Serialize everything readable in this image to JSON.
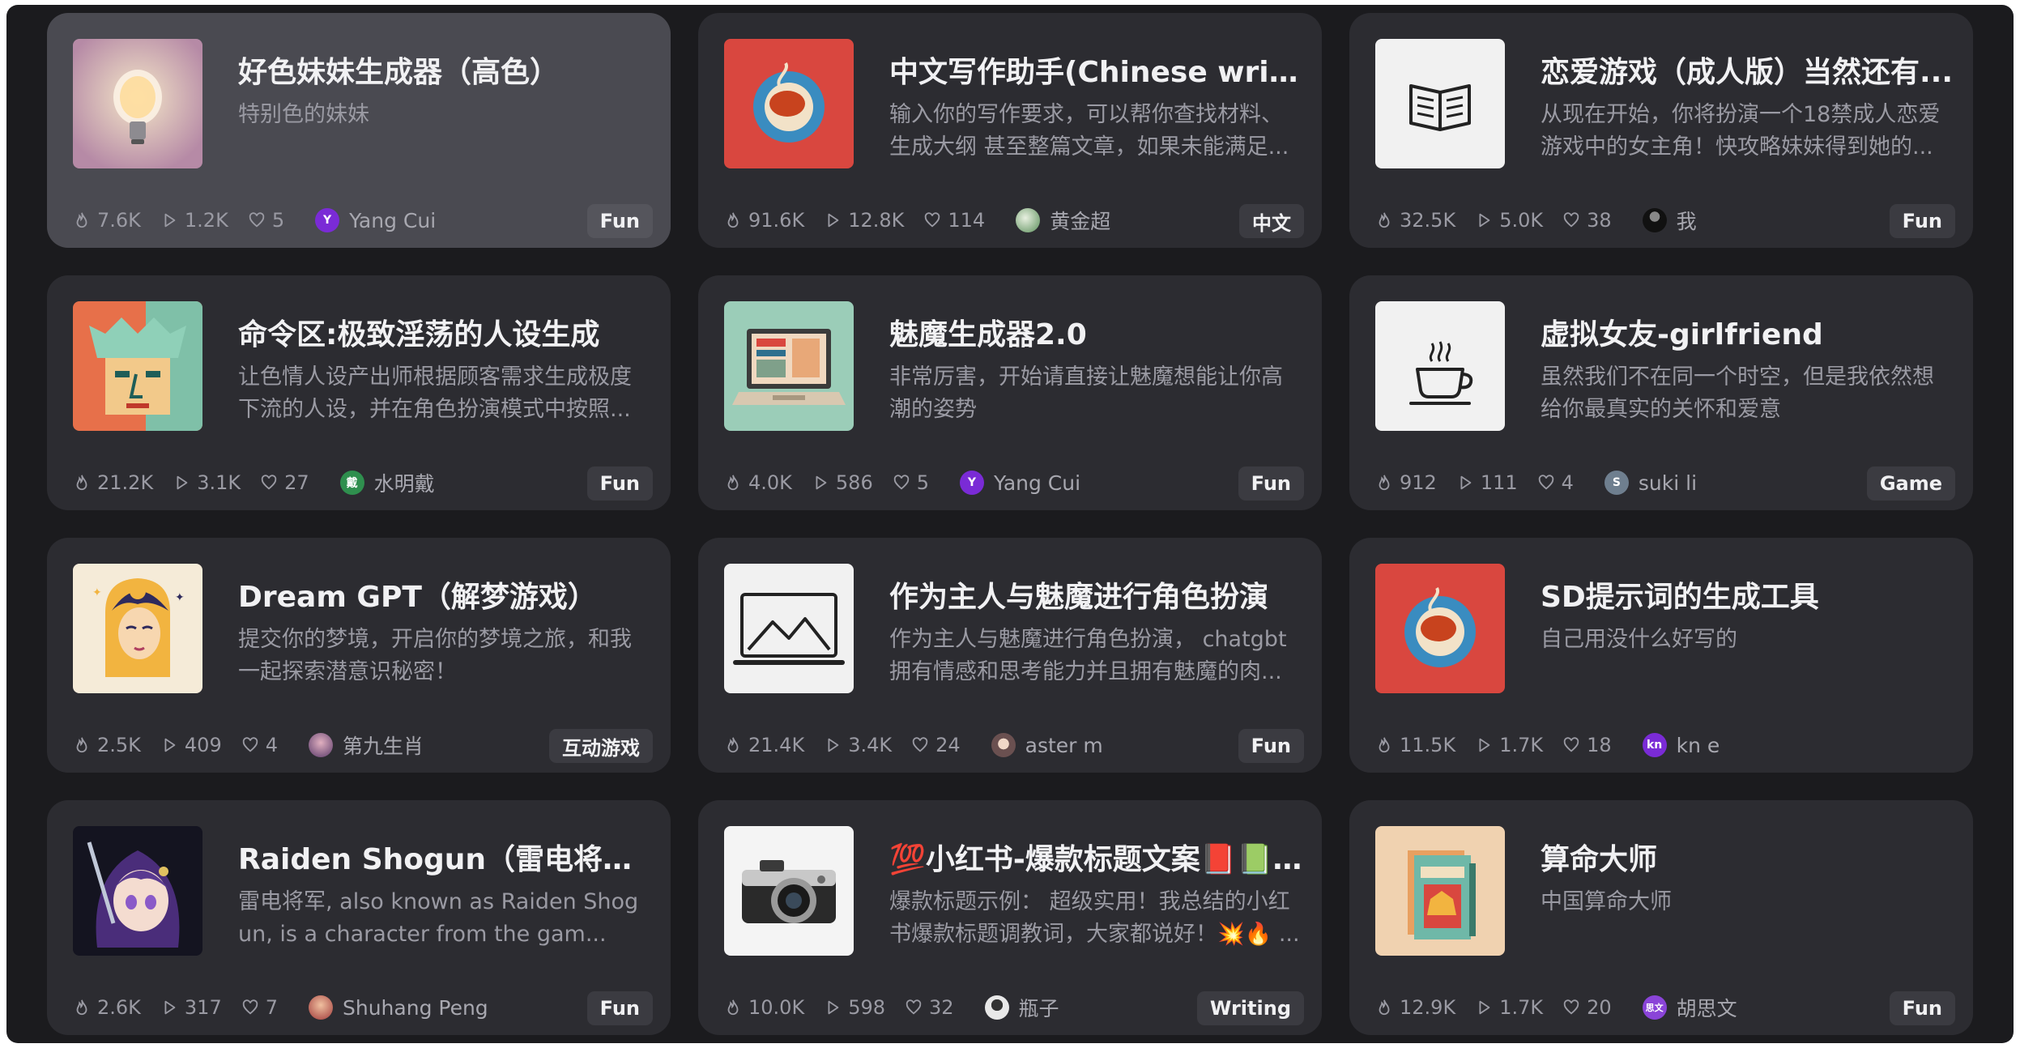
{
  "cards": [
    {
      "title": "好色妹妹生成器（高色）",
      "desc": "特别色的妹妹",
      "fire": "7.6K",
      "play": "1.2K",
      "like": "5",
      "author": "Yang Cui",
      "avatar_letter": "Y",
      "avatar_color": "#7a2bd6",
      "tag": "Fun"
    },
    {
      "title": "中文写作助手(Chinese writi...",
      "desc": "输入你的写作要求，可以帮你查找材料、生成大纲 甚至整篇文章，如果未能满足...",
      "fire": "91.6K",
      "play": "12.8K",
      "like": "114",
      "author": "黄金超",
      "avatar_letter": "",
      "avatar_color": "#6aa36a",
      "tag": "中文"
    },
    {
      "title": "恋爱游戏（成人版）当然还有...",
      "desc": "从现在开始，你将扮演一个18禁成人恋爱游戏中的女主角！快攻略妹妹得到她的...",
      "fire": "32.5K",
      "play": "5.0K",
      "like": "38",
      "author": "我",
      "avatar_letter": "",
      "avatar_color": "#333338",
      "tag": "Fun"
    },
    {
      "title": "命令区:极致淫荡的人设生成",
      "desc": "让色情人设产出师根据顾客需求生成极度下流的人设，并在角色扮演模式中按照...",
      "fire": "21.2K",
      "play": "3.1K",
      "like": "27",
      "author": "水明戴",
      "avatar_letter": "戴",
      "avatar_color": "#2f8f4e",
      "tag": "Fun"
    },
    {
      "title": "魅魔生成器2.0",
      "desc": "非常厉害，开始请直接让魅魔想能让你高潮的姿势",
      "fire": "4.0K",
      "play": "586",
      "like": "5",
      "author": "Yang Cui",
      "avatar_letter": "Y",
      "avatar_color": "#7a2bd6",
      "tag": "Fun"
    },
    {
      "title": "虚拟女友-girlfriend",
      "desc": "虽然我们不在同一个时空，但是我依然想给你最真实的关怀和爱意",
      "fire": "912",
      "play": "111",
      "like": "4",
      "author": "suki li",
      "avatar_letter": "S",
      "avatar_color": "#6f7f8f",
      "tag": "Game"
    },
    {
      "title": "Dream GPT（解梦游戏）",
      "desc": "提交你的梦境，开启你的梦境之旅，和我一起探索潜意识秘密！",
      "fire": "2.5K",
      "play": "409",
      "like": "4",
      "author": "第九生肖",
      "avatar_letter": "",
      "avatar_color": "#8a5a9a",
      "tag": "互动游戏"
    },
    {
      "title": "作为主人与魅魔进行角色扮演",
      "desc": "作为主人与魅魔进行角色扮演， chatgbt拥有情感和思考能力并且拥有魅魔的肉...",
      "fire": "21.4K",
      "play": "3.4K",
      "like": "24",
      "author": "aster m",
      "avatar_letter": "",
      "avatar_color": "#9a8070",
      "tag": "Fun"
    },
    {
      "title": "SD提示词的生成工具",
      "desc": "自己用没什么好写的",
      "fire": "11.5K",
      "play": "1.7K",
      "like": "18",
      "author": "kn e",
      "avatar_letter": "kn",
      "avatar_color": "#7a2bd6",
      "tag": ""
    },
    {
      "title": "Raiden Shogun（雷电将军）",
      "desc": "雷电将军, also known as Raiden Shogun, is a character from the gam...",
      "fire": "2.6K",
      "play": "317",
      "like": "7",
      "author": "Shuhang Peng",
      "avatar_letter": "",
      "avatar_color": "#a05050",
      "tag": "Fun"
    },
    {
      "title": "💯小红书-爆款标题文案📕📗...",
      "desc": "爆款标题示例： 超级实用！我总结的小红书爆款标题调教词，大家都说好！💥🔥 ...",
      "fire": "10.0K",
      "play": "598",
      "like": "32",
      "author": "瓶子",
      "avatar_letter": "",
      "avatar_color": "#e0e0e0",
      "tag": "Writing"
    },
    {
      "title": "算命大师",
      "desc": "中国算命大师",
      "fire": "12.9K",
      "play": "1.7K",
      "like": "20",
      "author": "胡思文",
      "avatar_letter": "思文",
      "avatar_color": "#8a44d8",
      "tag": "Fun"
    }
  ]
}
